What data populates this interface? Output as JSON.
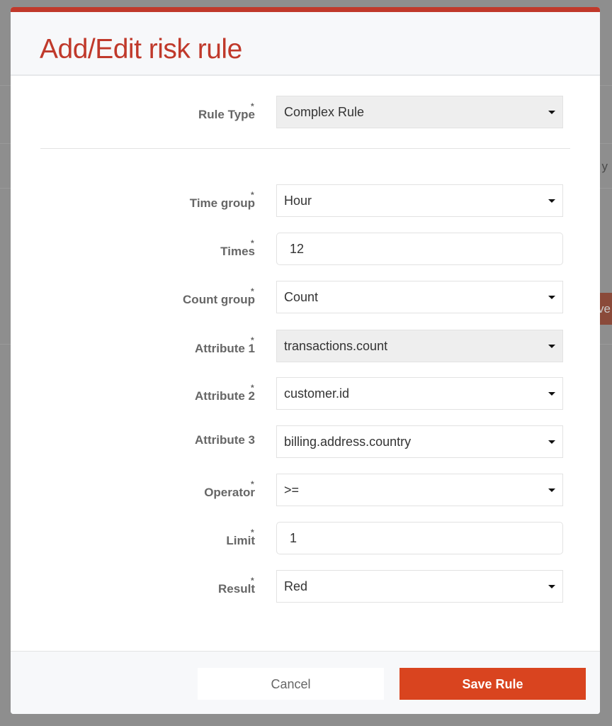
{
  "background": {
    "text_fragment": "y",
    "button_fragment": "ve"
  },
  "modal": {
    "title": "Add/Edit risk rule",
    "accent": "#c0392b"
  },
  "fields": [
    {
      "label": "Rule Type",
      "required": "*",
      "value": "Complex Rule",
      "type": "select",
      "disabled": true
    },
    {
      "label": "Time group",
      "required": "*",
      "value": "Hour",
      "type": "select"
    },
    {
      "label": "Times",
      "required": "*",
      "value": "12",
      "type": "input"
    },
    {
      "label": "Count group",
      "required": "*",
      "value": "Count",
      "type": "select"
    },
    {
      "label": "Attribute 1",
      "required": "*",
      "value": "transactions.count",
      "type": "select",
      "disabled": true
    },
    {
      "label": "Attribute 2",
      "required": "*",
      "value": "customer.id",
      "type": "select"
    },
    {
      "label": "Attribute 3",
      "required": "",
      "value": "billing.address.country",
      "type": "select"
    },
    {
      "label": "Operator",
      "required": "*",
      "value": ">=",
      "type": "select"
    },
    {
      "label": "Limit",
      "required": "*",
      "value": "1",
      "type": "input"
    },
    {
      "label": "Result",
      "required": "*",
      "value": "Red",
      "type": "select"
    }
  ],
  "footer": {
    "cancel_label": "Cancel",
    "save_label": "Save Rule",
    "save_color": "#d9441f"
  }
}
